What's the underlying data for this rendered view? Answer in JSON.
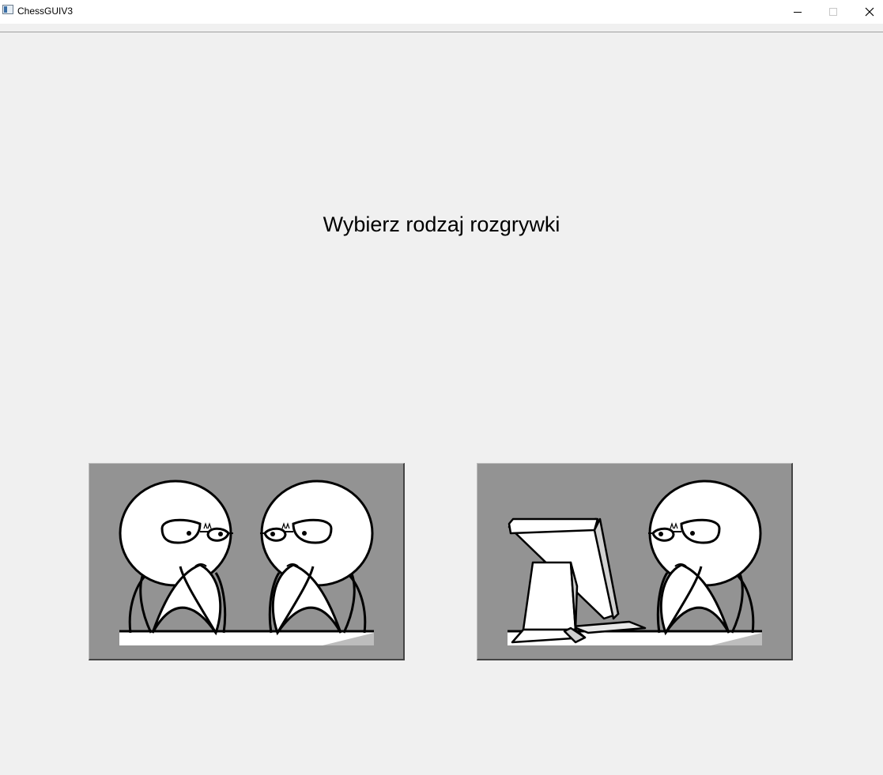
{
  "window": {
    "title": "ChessGUIV3",
    "icon": "app-window-icon",
    "controls": [
      "minimize-icon",
      "maximize-icon",
      "close-icon"
    ]
  },
  "main": {
    "heading": "Wybierz rodzaj rozgrywki"
  },
  "modes": [
    {
      "id": "player-vs-player",
      "image": "two-thinking-people-icon"
    },
    {
      "id": "player-vs-computer",
      "image": "computer-and-thinking-person-icon"
    }
  ],
  "colors": {
    "background": "#f0f0f0",
    "button_face": "#939393",
    "titlebar": "#ffffff"
  }
}
